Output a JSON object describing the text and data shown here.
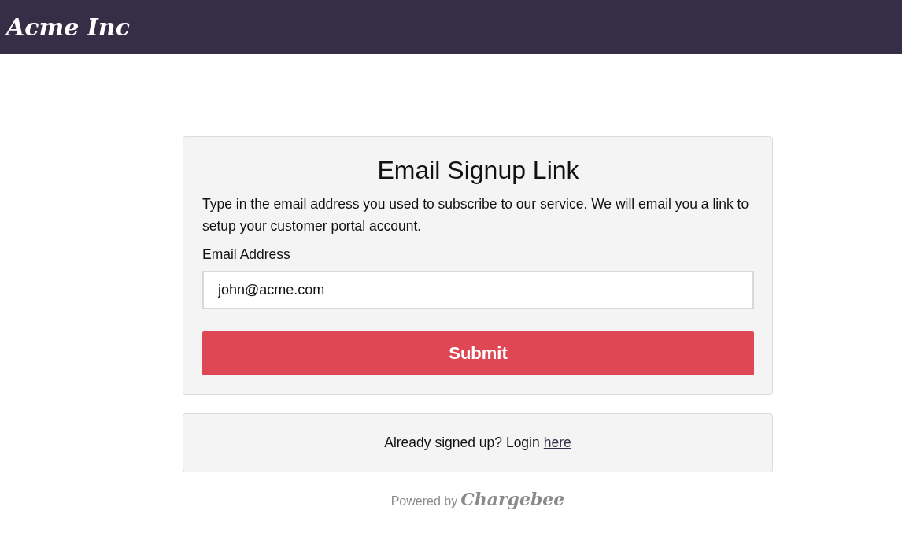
{
  "header": {
    "logo": "Acme Inc"
  },
  "form": {
    "title": "Email Signup Link",
    "description": "Type in the email address you used to subscribe to our service. We will email you a link to setup your customer portal account.",
    "field_label": "Email Address",
    "email": "john@acme.com",
    "submit": "Submit"
  },
  "login": {
    "text": "Already signed up? Login",
    "link": "here"
  },
  "footer": {
    "powered_by": "Powered by",
    "brand": "Chargebee"
  }
}
